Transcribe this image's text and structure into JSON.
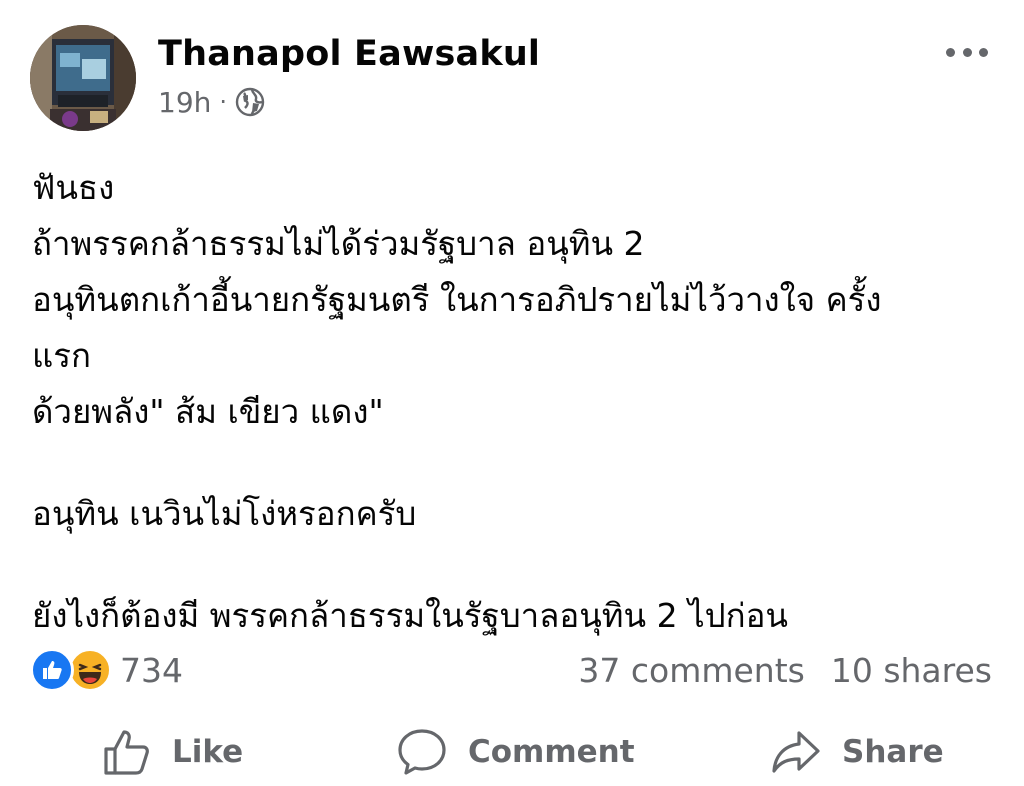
{
  "post": {
    "author": "Thanapol Eawsakul",
    "time": "19h",
    "separator": "·",
    "privacy_icon": "globe-icon",
    "more_icon": "more-horizontal-icon",
    "lines": [
      "ฟันธง",
      "ถ้าพรรคกล้าธรรมไม่ได้ร่วมรัฐบาล อนุทิน 2",
      "อนุทินตกเก้าอี้นายกรัฐมนตรี ในการอภิปรายไม่ไว้วางใจ ครั้ง",
      "แรก",
      "ด้วยพลัง\" ส้ม เขียว แดง\"",
      "",
      "อนุทิน เนวินไม่โง่หรอกครับ",
      "",
      "ยังไงก็ต้องมี พรรคกล้าธรรมในรัฐบาลอนุทิน  2 ไปก่อน"
    ]
  },
  "engagement": {
    "reaction_icons": [
      "like-reaction-icon",
      "haha-reaction-icon"
    ],
    "reaction_count": "734",
    "comments": "37 comments",
    "shares": "10 shares"
  },
  "actions": {
    "like": "Like",
    "comment": "Comment",
    "share": "Share"
  },
  "colors": {
    "text": "#050505",
    "secondary": "#65676b",
    "like_blue": "#1877f2",
    "haha_yellow": "#f7b125"
  }
}
